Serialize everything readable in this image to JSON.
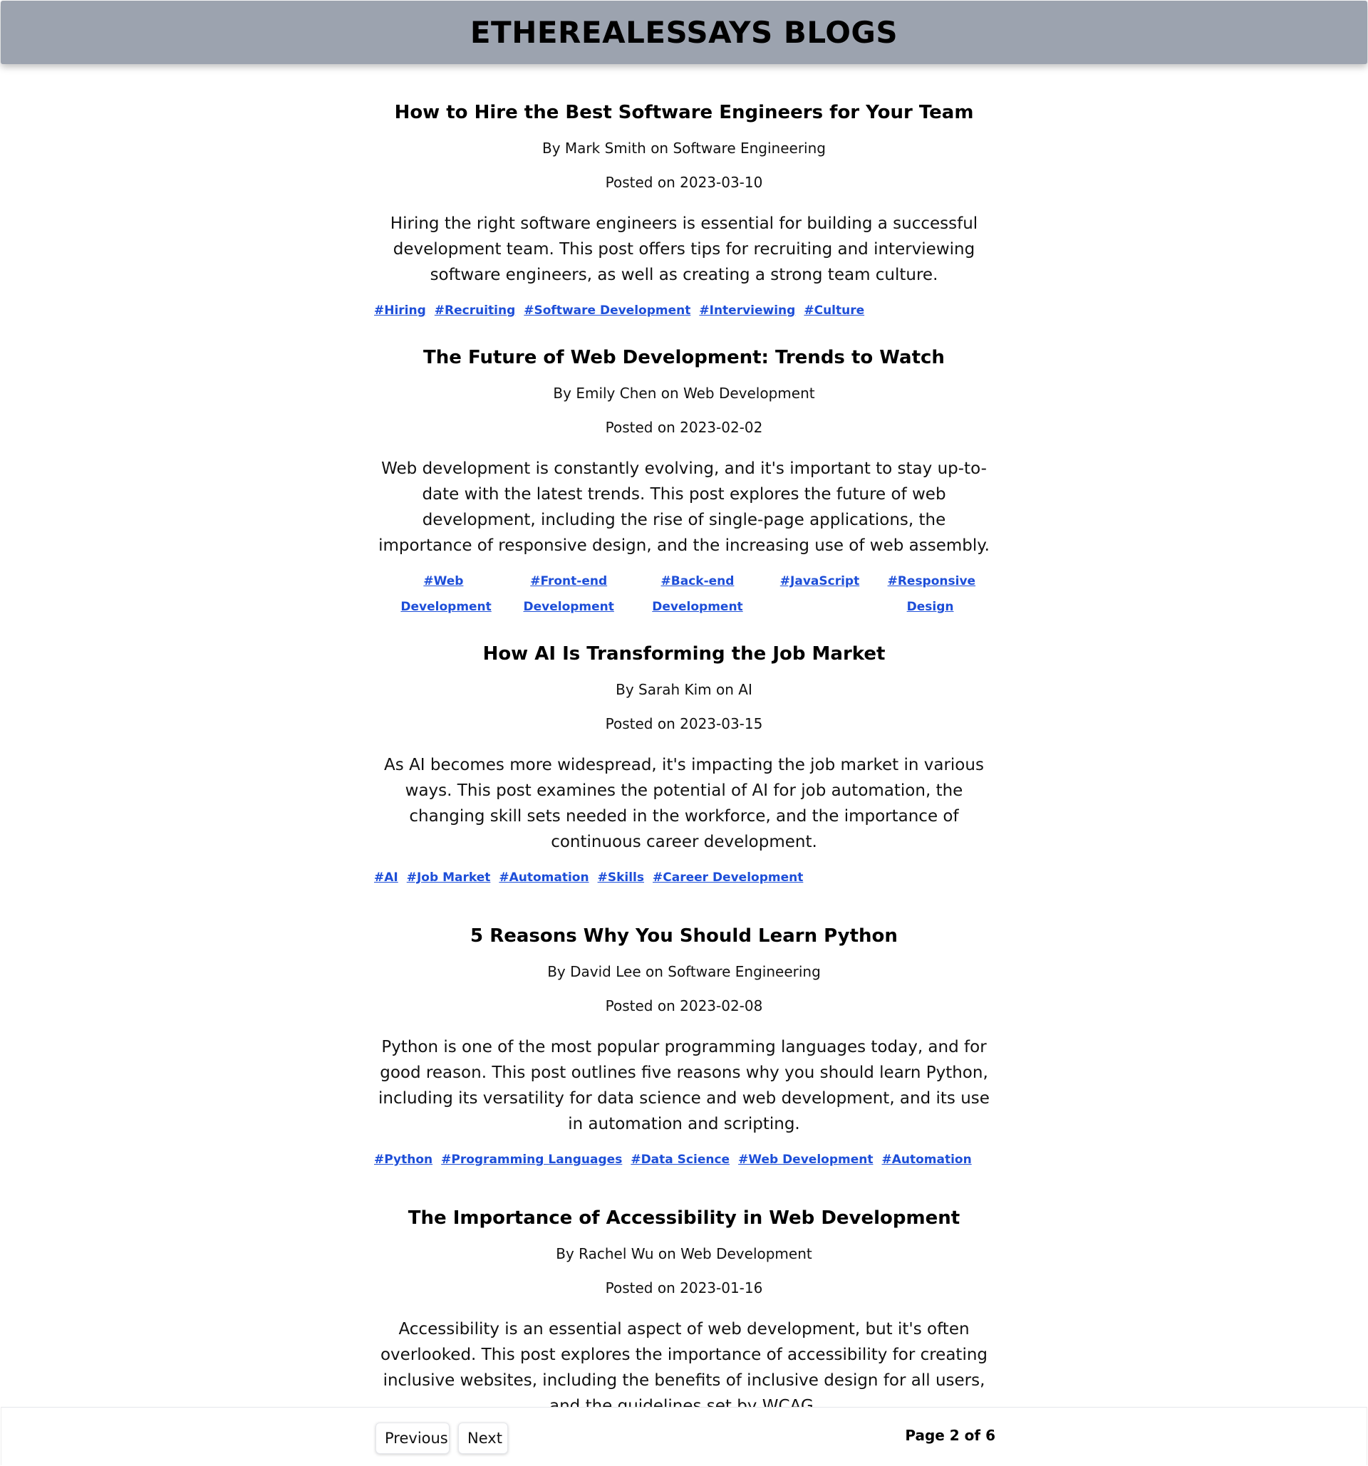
{
  "header": {
    "title": "ETHEREALESSAYS BLOGS"
  },
  "posts": [
    {
      "title": "How to Hire the Best Software Engineers for Your Team",
      "byline": "By Mark Smith on Software Engineering",
      "date": "Posted on 2023-03-10",
      "excerpt": "Hiring the right software engineers is essential for building a successful development team. This post offers tips for recruiting and interviewing software engineers, as well as creating a strong team culture.",
      "tags": [
        "#Hiring",
        "#Recruiting",
        "#Software Development",
        "#Interviewing",
        "#Culture"
      ]
    },
    {
      "title": "The Future of Web Development: Trends to Watch",
      "byline": "By Emily Chen on Web Development",
      "date": "Posted on 2023-02-02",
      "excerpt": "Web development is constantly evolving, and it's important to stay up-to-date with the latest trends. This post explores the future of web development, including the rise of single-page applications, the importance of responsive design, and the increasing use of web assembly.",
      "tags": [
        "#Web Development",
        "#Front-end Development",
        "#Back-end Development",
        "#JavaScript",
        "#Responsive Design"
      ]
    },
    {
      "title": "How AI Is Transforming the Job Market",
      "byline": "By Sarah Kim on AI",
      "date": "Posted on 2023-03-15",
      "excerpt": "As AI becomes more widespread, it's impacting the job market in various ways. This post examines the potential of AI for job automation, the changing skill sets needed in the workforce, and the importance of continuous career development.",
      "tags": [
        "#AI",
        "#Job Market",
        "#Automation",
        "#Skills",
        "#Career Development"
      ]
    },
    {
      "title": "5 Reasons Why You Should Learn Python",
      "byline": "By David Lee on Software Engineering",
      "date": "Posted on 2023-02-08",
      "excerpt": "Python is one of the most popular programming languages today, and for good reason. This post outlines five reasons why you should learn Python, including its versatility for data science and web development, and its use in automation and scripting.",
      "tags": [
        "#Python",
        "#Programming Languages",
        "#Data Science",
        "#Web Development",
        "#Automation"
      ]
    },
    {
      "title": "The Importance of Accessibility in Web Development",
      "byline": "By Rachel Wu on Web Development",
      "date": "Posted on 2023-01-16",
      "excerpt": "Accessibility is an essential aspect of web development, but it's often overlooked. This post explores the importance of accessibility for creating inclusive websites, including the benefits of inclusive design for all users, and the guidelines set by WCAG."
    }
  ],
  "pagination": {
    "previous_label": "Previous",
    "next_label": "Next",
    "indicator": "Page 2 of 6"
  }
}
